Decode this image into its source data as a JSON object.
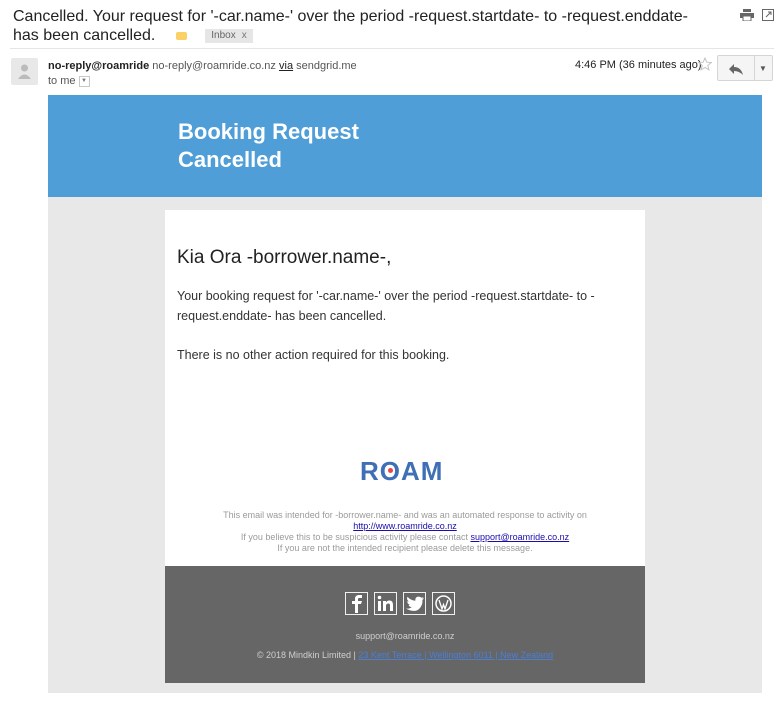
{
  "subject": {
    "text": "Cancelled. Your request for '-car.name-' over the period -request.startdate- to -request.enddate- has been cancelled.",
    "inbox_label": "Inbox",
    "remove_label": "x"
  },
  "sender": {
    "name": "no-reply@roamride",
    "address": "no-reply@roamride.co.nz",
    "via_label": "via",
    "via_domain": "sendgrid.me",
    "recipient": "to me",
    "timestamp": "4:46 PM (36 minutes ago)"
  },
  "banner": {
    "title_line1": "Booking Request",
    "title_line2": "Cancelled",
    "color": "#4f9ed8"
  },
  "body": {
    "greeting": "Kia Ora -borrower.name-,",
    "paragraph1": "Your booking request for '-car.name-' over the period -request.startdate- to -request.enddate- has been cancelled.",
    "paragraph2": "There is no other action required for this booking."
  },
  "logo": {
    "text_r": "R",
    "text_o": "O",
    "text_am": "AM"
  },
  "disclaimer": {
    "line1": "This email was intended for -borrower.name- and was an automated response to activity on",
    "link1": "http://www.roamride.co.nz",
    "line3_prefix": "If you believe this to be suspicious activity please contact",
    "link2": "support@roamride.co.nz",
    "line4": "If you are not the intended recipient please delete this message."
  },
  "footer": {
    "social_icons": [
      "facebook-icon",
      "linkedin-icon",
      "twitter-icon",
      "wordpress-icon"
    ],
    "email": "support@roamride.co.nz",
    "copyright": "© 2018 Mindkin Limited |",
    "address_link": "23 Kent Terrace | Wellington 6011 | New Zealand"
  }
}
